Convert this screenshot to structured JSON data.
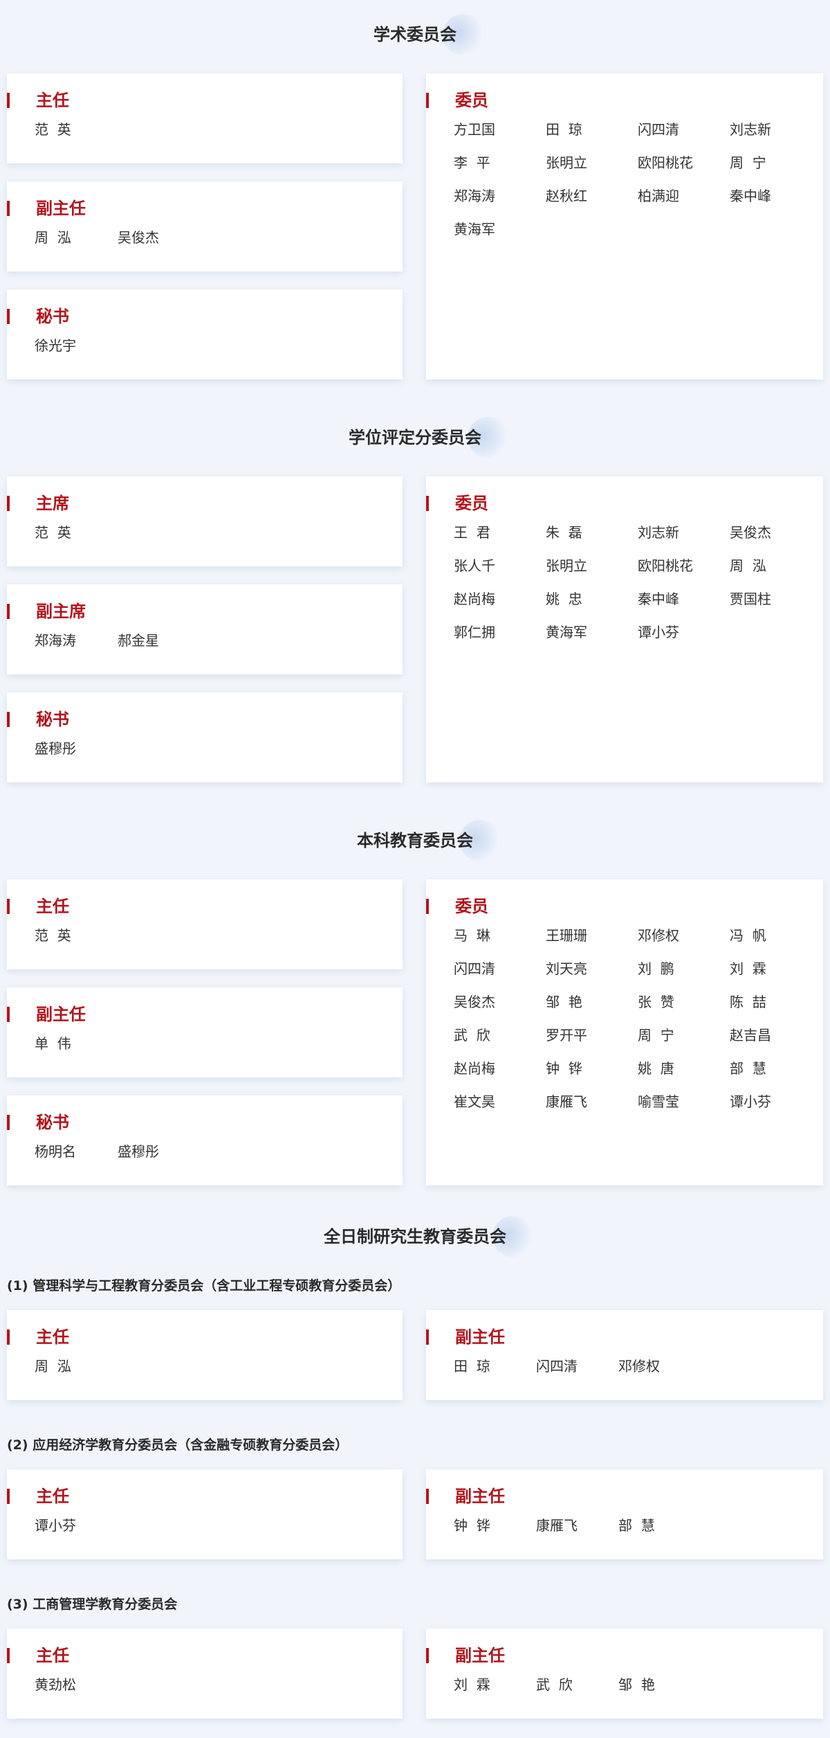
{
  "sections": [
    {
      "title": "学术委员会",
      "cards": [
        {
          "title": "主任",
          "names": [
            "范  英"
          ]
        },
        {
          "title": "副主任",
          "names": [
            "周  泓",
            "吴俊杰"
          ]
        },
        {
          "title": "秘书",
          "names": [
            "徐光宇"
          ]
        },
        {
          "title": "委员",
          "names": [
            "方卫国",
            "田  琼",
            "闪四清",
            "刘志新",
            "李  平",
            "张明立",
            "欧阳桃花",
            "周  宁",
            "郑海涛",
            "赵秋红",
            "柏满迎",
            "秦中峰",
            "黄海军"
          ]
        }
      ]
    },
    {
      "title": "学位评定分委员会",
      "cards": [
        {
          "title": "主席",
          "names": [
            "范  英"
          ]
        },
        {
          "title": "副主席",
          "names": [
            "郑海涛",
            "郝金星"
          ]
        },
        {
          "title": "秘书",
          "names": [
            "盛穆彤"
          ]
        },
        {
          "title": "委员",
          "names": [
            "王  君",
            "朱  磊",
            "刘志新",
            "吴俊杰",
            "张人千",
            "张明立",
            "欧阳桃花",
            "周  泓",
            "赵尚梅",
            "姚  忠",
            "秦中峰",
            "贾国柱",
            "郭仁拥",
            "黄海军",
            "谭小芬"
          ]
        }
      ]
    },
    {
      "title": "本科教育委员会",
      "cards": [
        {
          "title": "主任",
          "names": [
            "范  英"
          ]
        },
        {
          "title": "副主任",
          "names": [
            "单  伟"
          ]
        },
        {
          "title": "秘书",
          "names": [
            "杨明名",
            "盛穆彤"
          ]
        },
        {
          "title": "委员",
          "names": [
            "马  琳",
            "王珊珊",
            "邓修权",
            "冯  帆",
            "闪四清",
            "刘天亮",
            "刘  鹏",
            "刘  霖",
            "吴俊杰",
            "邹  艳",
            "张  赞",
            "陈  喆",
            "武  欣",
            "罗开平",
            "周  宁",
            "赵吉昌",
            "赵尚梅",
            "钟  铧",
            "姚  唐",
            "部  慧",
            "崔文昊",
            "康雁飞",
            "喻雪莹",
            "谭小芬"
          ]
        }
      ]
    },
    {
      "title": "全日制研究生教育委员会",
      "subsections": [
        {
          "title": "(1) 管理科学与工程教育分委员会（含工业工程专硕教育分委员会）",
          "cards": [
            {
              "title": "主任",
              "names": [
                "周  泓"
              ]
            },
            {
              "title": "副主任",
              "names": [
                "田  琼",
                "闪四清",
                "邓修权"
              ]
            }
          ]
        },
        {
          "title": "(2) 应用经济学教育分委员会（含金融专硕教育分委员会）",
          "cards": [
            {
              "title": "主任",
              "names": [
                "谭小芬"
              ]
            },
            {
              "title": "副主任",
              "names": [
                "钟  铧",
                "康雁飞",
                "部  慧"
              ]
            }
          ]
        },
        {
          "title": "(3) 工商管理学教育分委员会",
          "cards": [
            {
              "title": "主任",
              "names": [
                "黄劲松"
              ]
            },
            {
              "title": "副主任",
              "names": [
                "刘  霖",
                "武  欣",
                "邹  艳"
              ]
            }
          ]
        }
      ]
    }
  ]
}
